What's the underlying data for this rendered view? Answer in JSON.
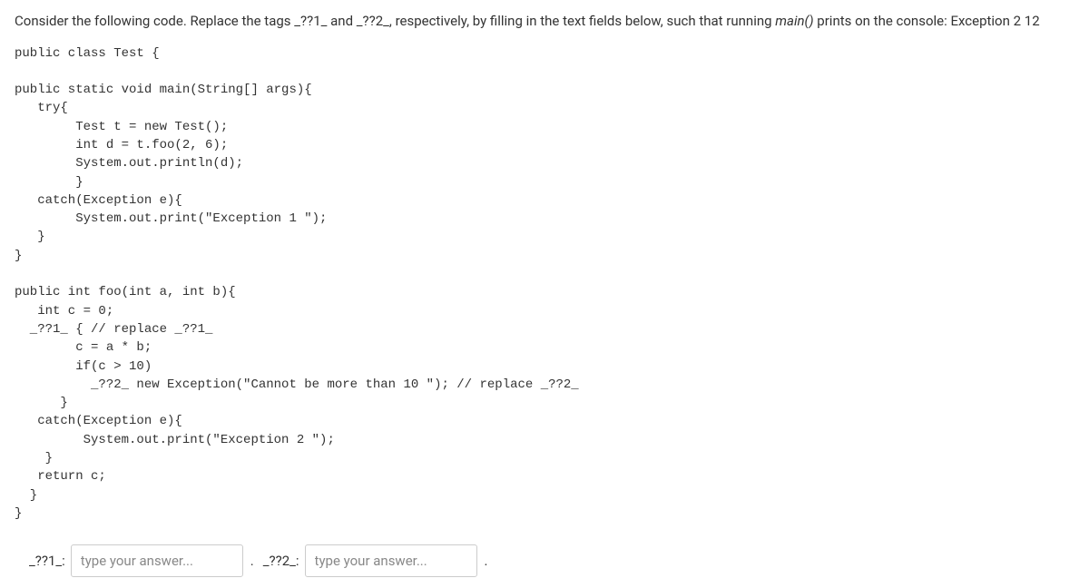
{
  "instruction_prefix": "Consider the following code. Replace the tags _??1_ and _??2_, respectively, by filling in the text fields below, such that running ",
  "instruction_italic": "main()",
  "instruction_suffix": " prints on the console: Exception 2 12",
  "code": "public class Test {\n\npublic static void main(String[] args){\n   try{\n        Test t = new Test();\n        int d = t.foo(2, 6);\n        System.out.println(d);\n        }\n   catch(Exception e){\n        System.out.print(\"Exception 1 \");\n   }\n}\n\npublic int foo(int a, int b){\n   int c = 0;\n  _??1_ { // replace _??1_\n        c = a * b;\n        if(c > 10)\n          _??2_ new Exception(\"Cannot be more than 10 \"); // replace _??2_\n      }\n   catch(Exception e){\n         System.out.print(\"Exception 2 \");\n    }\n   return c;\n  }\n}",
  "answer1_label": "_??1_:",
  "answer1_placeholder": "type your answer...",
  "sep1": ".",
  "answer2_label": "_??2_:",
  "answer2_placeholder": "type your answer...",
  "sep2": "."
}
